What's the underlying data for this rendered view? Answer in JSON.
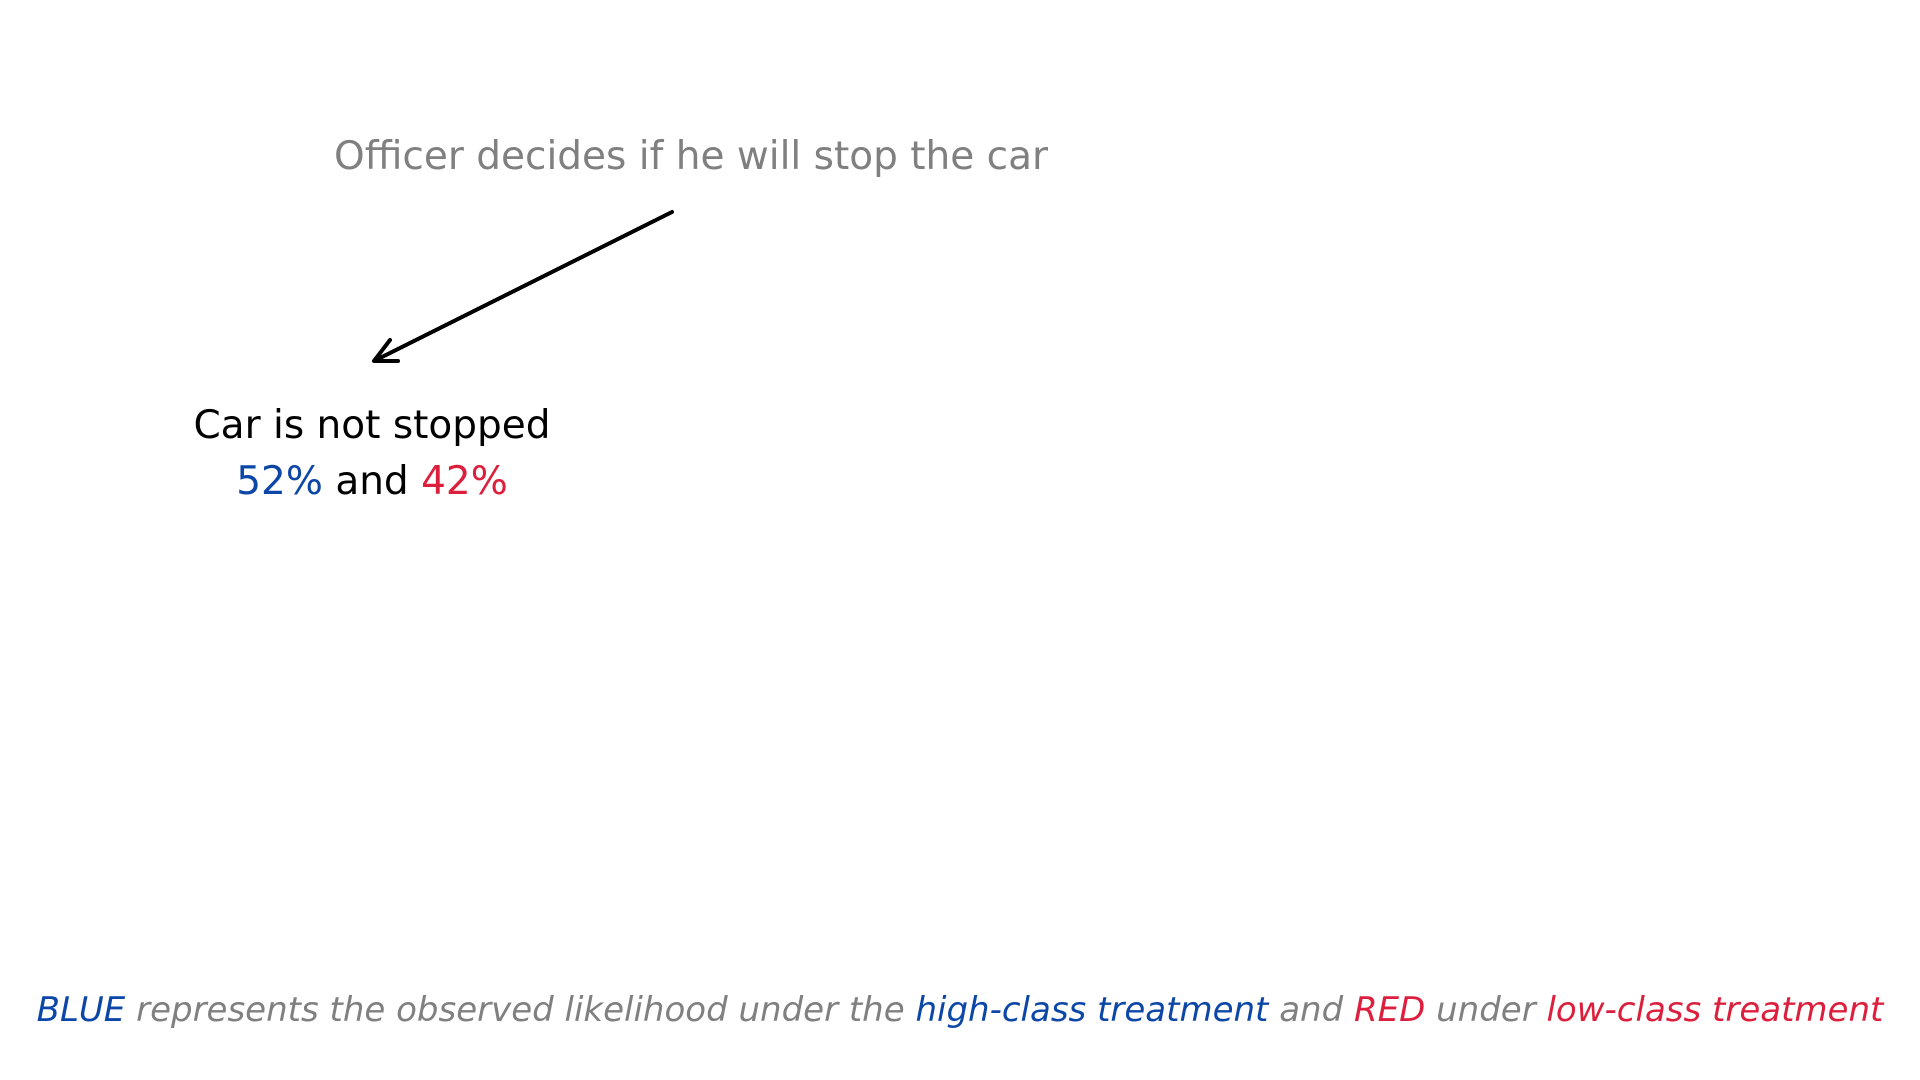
{
  "colors": {
    "blue": "#0c47a8",
    "red": "#dc1f3c",
    "gray": "#808080",
    "black": "#000000"
  },
  "decision": {
    "text": "Officer decides if he will stop the car"
  },
  "outcome": {
    "label": "Car is not stopped",
    "blue_value": "52%",
    "connector": "and",
    "red_value": "42%"
  },
  "legend": {
    "blue_word": "BLUE",
    "part1": "represents the observed likelihood under the",
    "high_class": "high-class treatment",
    "and": "and",
    "red_word": "RED",
    "under": "under",
    "low_class": "low-class treatment"
  }
}
